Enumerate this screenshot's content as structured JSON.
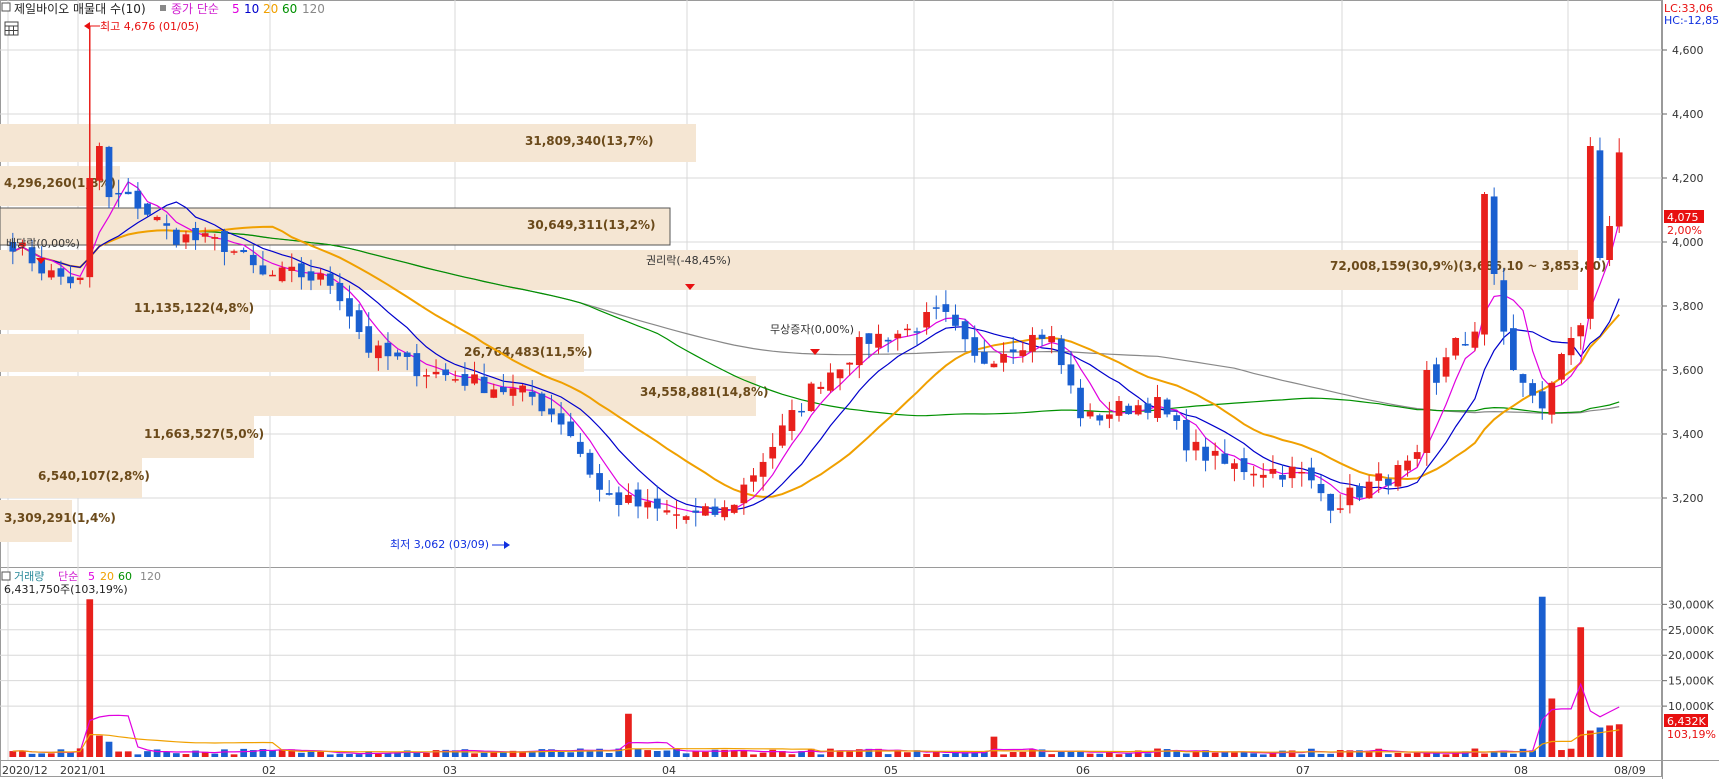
{
  "legend_top": {
    "stock": "제일바이오 매물대 수(10)",
    "ma_label": "종가 단순",
    "periods": [
      "5",
      "10",
      "20",
      "60",
      "120"
    ],
    "period_colors": [
      "#e000e0",
      "#0000cc",
      "#f0a000",
      "#009000",
      "#888888"
    ]
  },
  "legend_volume": {
    "label": "거래량",
    "ma_label": "단순",
    "periods": [
      "5",
      "20",
      "60",
      "120"
    ],
    "period_colors": [
      "#e000e0",
      "#f0a000",
      "#009000",
      "#888888"
    ],
    "current": "6,431,750주(103,19%)"
  },
  "corner": {
    "lc": "LC:33,06",
    "hc": "HC:-12,85"
  },
  "current_price": {
    "value": "4,075",
    "change": "2,00%"
  },
  "current_volume": {
    "value": "6,432K",
    "ratio": "103,19%"
  },
  "annotations": {
    "high": "최고 4,676 (01/05)",
    "low": "최저 3,062 (03/09)",
    "dividend": "배당락(0,00%)",
    "rights": "권리락(-48,45%)",
    "bonus": "무상증자(0,00%)"
  },
  "volume_profile": [
    {
      "label": "31,809,340(13,7%)"
    },
    {
      "label": "30,649,311(13,2%)"
    },
    {
      "label": "72,008,159(30,9%)(3,686,10 ~ 3,853,80)"
    },
    {
      "label": "4,296,260(1,8%)"
    },
    {
      "label": "11,135,122(4,8%)"
    },
    {
      "label": "26,764,483(11,5%)"
    },
    {
      "label": "34,558,881(14,8%)"
    },
    {
      "label": "11,663,527(5,0%)"
    },
    {
      "label": "6,540,107(2,8%)"
    },
    {
      "label": "3,309,291(1,4%)"
    }
  ],
  "x_labels": [
    "2020/12",
    "2021/01",
    "02",
    "03",
    "04",
    "05",
    "06",
    "07",
    "08",
    "08/09"
  ],
  "colors": {
    "up": "#e8201c",
    "down": "#1a5fd0",
    "profile": "#f5e6d3",
    "grid": "#d8d8d8"
  },
  "chart_data": [
    {
      "type": "candlestick",
      "title": "제일바이오 매물대 수(10)",
      "ylim": [
        3000,
        4700
      ],
      "yticks": [
        "4,600",
        "4,400",
        "4,200",
        "4,000",
        "3,800",
        "3,600",
        "3,400",
        "3,200"
      ],
      "ytick_values": [
        4600,
        4400,
        4200,
        4000,
        3800,
        3600,
        3400,
        3200
      ],
      "xlabels": [
        "2020/12",
        "2021/01",
        "02",
        "03",
        "04",
        "05",
        "06",
        "07",
        "08",
        "08/09"
      ],
      "moving_averages": [
        "5",
        "10",
        "20",
        "60",
        "120"
      ],
      "notes": "Daily OHLC from 2020/12 to 2021/08/09; the high 4,676 on 01/05 and the low 3,062 on 03/09 are printed; other values are estimated from the picture."
    },
    {
      "type": "bar",
      "title": "거래량",
      "ylim": [
        0,
        34000
      ],
      "yticks": [
        "30,000K",
        "25,000K",
        "20,000K",
        "15,000K",
        "10,000K"
      ],
      "ytick_values": [
        30000,
        25000,
        20000,
        15000,
        10000
      ],
      "unit": "K",
      "current": "6,432K"
    }
  ]
}
